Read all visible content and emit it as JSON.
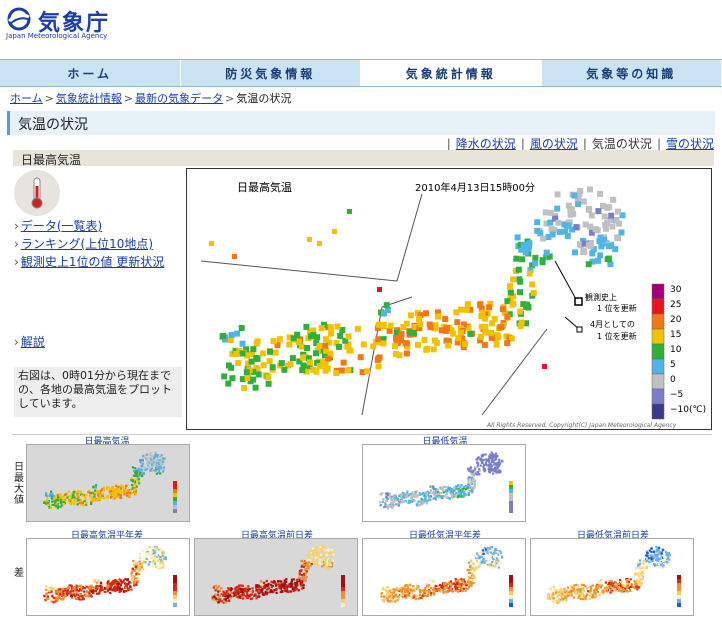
{
  "logo": {
    "jp": "気象庁",
    "en": "Japan Meteorological Agency"
  },
  "nav": [
    {
      "label": "ホーム",
      "active": false
    },
    {
      "label": "防災気象情報",
      "active": false
    },
    {
      "label": "気象統計情報",
      "active": true
    },
    {
      "label": "気象等の知識",
      "active": false
    }
  ],
  "breadcrumb": {
    "items": [
      "ホーム",
      "気象統計情報",
      "最新の気象データ"
    ],
    "current": "気温の状況"
  },
  "page_title": "気温の状況",
  "subnav": {
    "rain": "降水の状況",
    "wind": "風の状況",
    "temp": "気温の状況",
    "snow": "雪の状況"
  },
  "section_title": "日最高気温",
  "side_links": [
    "データ(一覧表)",
    "ランキング(上位10地点)",
    "観測史上1位の値 更新状況"
  ],
  "kaisetsu": "解説",
  "description": "右図は、0時01分から現在までの、各地の最高気温をプロットしています。",
  "map": {
    "title": "日最高気温",
    "datetime": "2010年4月13日15時00分",
    "legend_record_1": "観測史上",
    "legend_record_2": "1 位を更新",
    "legend_april_1": "4月としての",
    "legend_april_2": "1 位を更新",
    "scale": [
      {
        "label": "30",
        "color": "#a0007a"
      },
      {
        "label": "25",
        "color": "#e8141e"
      },
      {
        "label": "20",
        "color": "#f07818"
      },
      {
        "label": "15",
        "color": "#f2c200"
      },
      {
        "label": "10",
        "color": "#2fb03a"
      },
      {
        "label": "5",
        "color": "#4fb4e6"
      },
      {
        "label": "0",
        "color": "#c0c0c0"
      },
      {
        "label": "−5",
        "color": "#7a7ec8"
      },
      {
        "label": "−10",
        "color": "#3a3a8c"
      }
    ],
    "unit": "(℃)",
    "copyright": "All Rights Reserved, Copyright(C) Japan Meteorological Agency"
  },
  "thumbs": {
    "row1_label": "日最大値",
    "row2_label": "差",
    "t1": "日最高気温",
    "t2": "日最低気温",
    "t3": "日最高気温平年差",
    "t4": "日最高気温前日差",
    "t5": "日最低気温平年差",
    "t6": "日最低気温前日差"
  }
}
